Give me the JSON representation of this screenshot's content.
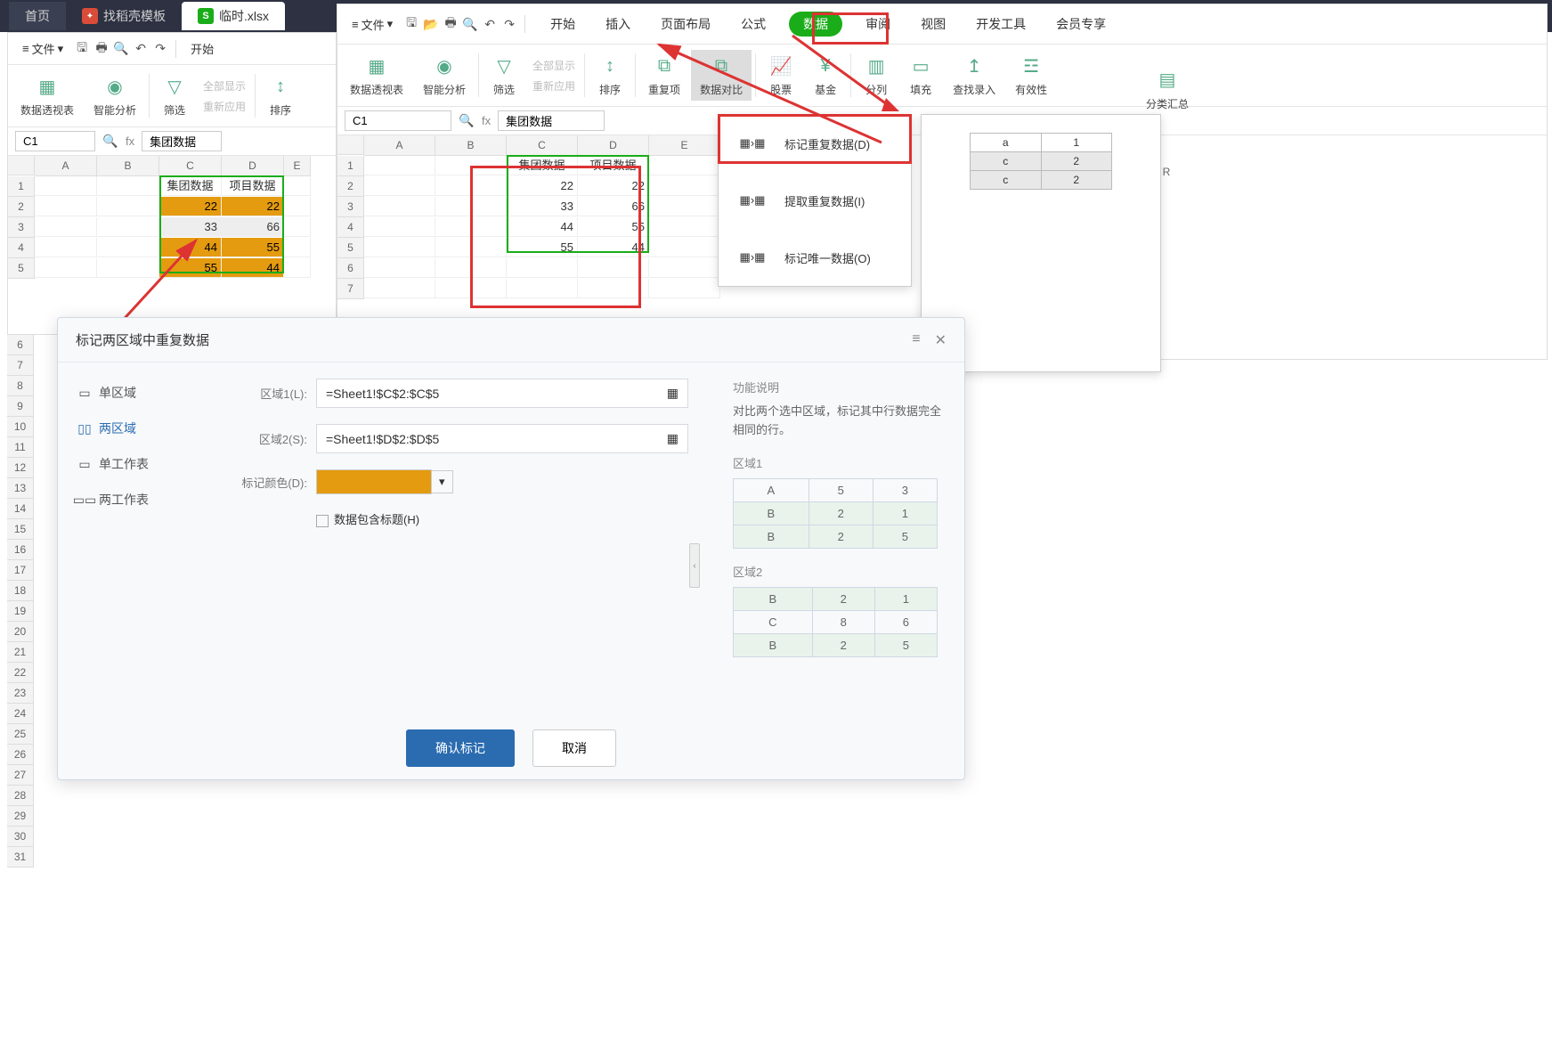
{
  "topbar": {
    "home": "首页",
    "template": "找稻壳模板",
    "file": "临时.xlsx"
  },
  "menu": {
    "file": "文件",
    "start": "开始",
    "insert": "插入",
    "pagelayout": "页面布局",
    "formula": "公式",
    "data": "数据",
    "review": "审阅",
    "view": "视图",
    "devtools": "开发工具",
    "member": "会员专享"
  },
  "ribbon": {
    "pivot": "数据透视表",
    "smart": "智能分析",
    "filter": "筛选",
    "showall": "全部显示",
    "reapply": "重新应用",
    "sort": "排序",
    "dup": "重复项",
    "compare": "数据对比",
    "stock": "股票",
    "fund": "基金",
    "split": "分列",
    "fill": "填充",
    "lookup": "查找录入",
    "valid": "有效性",
    "group": "分类汇总"
  },
  "cellref": {
    "cell": "C1",
    "val": "集团数据",
    "fx": "fx"
  },
  "gridLeft": {
    "cols": [
      "A",
      "B",
      "C",
      "D",
      "E"
    ],
    "rows": [
      "1",
      "2",
      "3",
      "4",
      "5"
    ],
    "headers": [
      "集团数据",
      "项目数据"
    ],
    "data": [
      [
        "22",
        "22"
      ],
      [
        "33",
        "66"
      ],
      [
        "44",
        "55"
      ],
      [
        "55",
        "44"
      ]
    ]
  },
  "gridRight": {
    "cols": [
      "A",
      "B",
      "C",
      "D",
      "E"
    ],
    "rows": [
      "1",
      "2",
      "3",
      "4",
      "5",
      "6",
      "7"
    ],
    "headers": [
      "集团数据",
      "项目数据"
    ],
    "data": [
      [
        "22",
        "22"
      ],
      [
        "33",
        "66"
      ],
      [
        "44",
        "55"
      ],
      [
        "55",
        "44"
      ]
    ]
  },
  "dropdown": {
    "mark": "标记重复数据(D)",
    "extract": "提取重复数据(I)",
    "unique": "标记唯一数据(O)"
  },
  "preview": {
    "rows": [
      [
        "a",
        "1"
      ],
      [
        "c",
        "2"
      ],
      [
        "c",
        "2"
      ]
    ]
  },
  "dialog": {
    "title": "标记两区域中重复数据",
    "side": {
      "single": "单区域",
      "double": "两区域",
      "sheet1": "单工作表",
      "sheet2": "两工作表"
    },
    "labels": {
      "r1": "区域1(L):",
      "r2": "区域2(S):",
      "color": "标记颜色(D):",
      "check": "数据包含标题(H)"
    },
    "inputs": {
      "r1": "=Sheet1!$C$2:$C$5",
      "r2": "=Sheet1!$D$2:$D$5"
    },
    "desc": {
      "title": "功能说明",
      "text": "对比两个选中区域，标记其中行数据完全相同的行。",
      "a1": "区域1",
      "a2": "区域2"
    },
    "table1": [
      [
        "A",
        "5",
        "3"
      ],
      [
        "B",
        "2",
        "1"
      ],
      [
        "B",
        "2",
        "5"
      ]
    ],
    "table2": [
      [
        "B",
        "2",
        "1"
      ],
      [
        "C",
        "8",
        "6"
      ],
      [
        "B",
        "2",
        "5"
      ]
    ],
    "confirm": "确认标记",
    "cancel": "取消"
  }
}
